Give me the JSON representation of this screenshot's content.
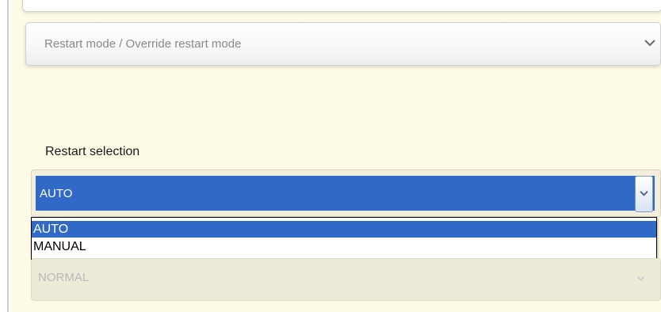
{
  "accordion": {
    "title": "Restart mode / Override restart mode",
    "expanded": false
  },
  "restart_selection": {
    "label": "Restart selection",
    "value": "AUTO",
    "options": [
      "AUTO",
      "MANUAL"
    ],
    "highlighted_option": "AUTO"
  },
  "restart_override": {
    "value": "NORMAL",
    "disabled": true
  },
  "icons": {
    "accordion_toggle": "chevron-down-icon",
    "select_toggle": "chevron-down-icon"
  },
  "colors": {
    "background": "#fdfae6",
    "selection_blue": "#3169c6",
    "disabled_text": "#b8b8b8"
  }
}
